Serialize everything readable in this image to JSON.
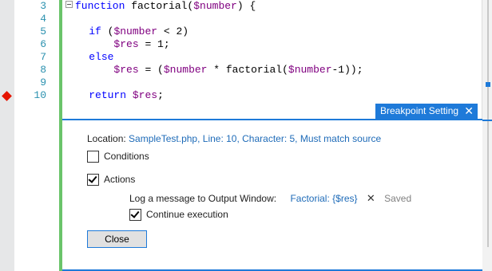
{
  "editor": {
    "line_numbers": [
      "3",
      "4",
      "5",
      "6",
      "7",
      "8",
      "9",
      "10"
    ],
    "code": {
      "line3": {
        "kw": "function",
        "rest": " factorial(",
        "var": "$number",
        "end": ") {"
      },
      "line5": {
        "kw": "if",
        "open": " (",
        "var": "$number",
        "rest": " < 2)"
      },
      "line6": {
        "var": "$res",
        "rest": " = 1;"
      },
      "line7": {
        "kw": "else"
      },
      "line8": {
        "var1": "$res",
        "mid1": " = (",
        "var2": "$number",
        "mid2": " * factorial(",
        "var3": "$number",
        "end": "-1));"
      },
      "line10": {
        "kw": "return",
        "space": " ",
        "var": "$res",
        "end": ";"
      }
    }
  },
  "breakpoint_setting": {
    "tab_title": "Breakpoint Setting",
    "close_glyph": "✕",
    "location_label": "Location:",
    "location_value": "SampleTest.php, Line: 10, Character: 5, Must match source",
    "conditions_label": "Conditions",
    "conditions_checked": false,
    "actions_label": "Actions",
    "actions_checked": true,
    "log_label": "Log a message to Output Window:",
    "log_value": "Factorial: {$res}",
    "log_delete_glyph": "✕",
    "saved_label": "Saved",
    "continue_label": "Continue execution",
    "continue_checked": true,
    "close_button_label": "Close"
  },
  "colors": {
    "accent": "#1e7ad9",
    "breakpoint": "#e51400",
    "change_bar": "#6ac46a",
    "line_number": "#2b91af",
    "keyword": "#0000ff",
    "variable": "#800080"
  }
}
